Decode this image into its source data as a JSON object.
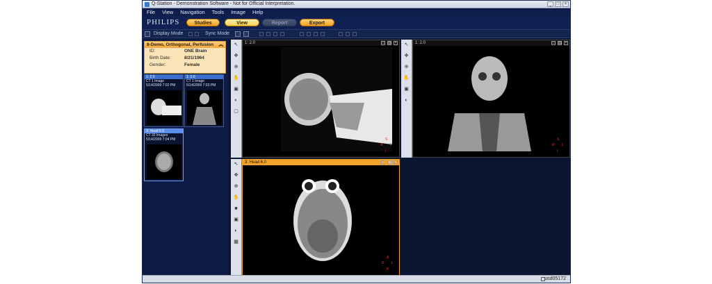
{
  "window": {
    "title": "Q-Station - Demonstration Software - Not for Official Interpretation."
  },
  "menu": [
    "File",
    "View",
    "Navigation",
    "Tools",
    "Image",
    "Help"
  ],
  "brand": "PHILIPS",
  "nav": {
    "studies": "Studies",
    "view": "View",
    "report": "Report",
    "export": "Export"
  },
  "toolbar": {
    "display_mode": "Display Mode",
    "sync_mode": "Sync Mode"
  },
  "patient": {
    "header": "8-Demo, Orthogonal, Perfusion",
    "id_label": "ID:",
    "id_value": "ONE Brain",
    "birth_label": "Birth Date:",
    "birth_value": "8/21/1964",
    "gender_label": "Gender:",
    "gender_value": "Female"
  },
  "series": [
    {
      "header": "1: 2.0",
      "line1": "CT 1 Image",
      "line2": "5/14/2009 7:02 PM"
    },
    {
      "header": "1: 2.0",
      "line1": "CT 1 Image",
      "line2": "5/14/2009 7:03 PM"
    },
    {
      "header": "3: Head 6.0",
      "line1": "CT 32 Images",
      "line2": "5/14/2009 7:04 PM"
    }
  ],
  "viewports": [
    {
      "label": "1: 2.0"
    },
    {
      "label": "1: 2.0"
    },
    {
      "label": "3: Head 6.0"
    }
  ],
  "orientation": {
    "top": "S",
    "bottom": "I",
    "left1": "A",
    "right1": "P",
    "left2": "R",
    "right2": "L",
    "top3": "A",
    "bottom3": "P"
  },
  "status": {
    "user": "usd05172"
  },
  "colors": {
    "accent": "#f0a11e",
    "background": "#0b1633"
  }
}
